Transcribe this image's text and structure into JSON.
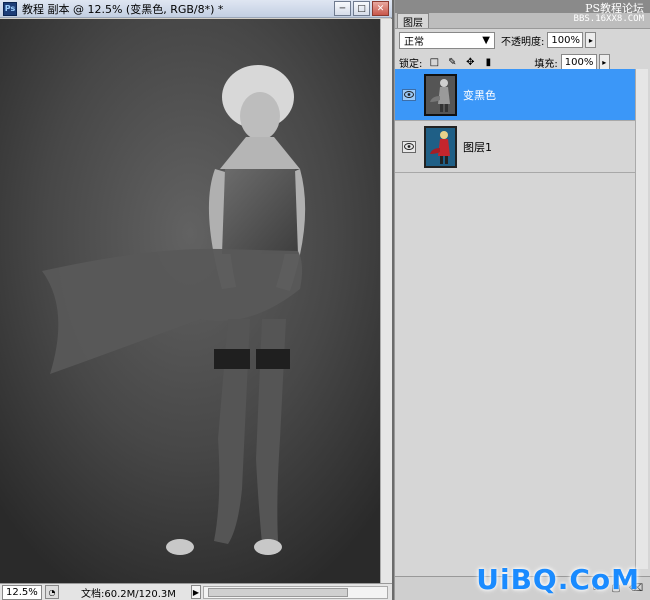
{
  "document": {
    "app_icon": "Ps",
    "title": "教程 副本 @ 12.5% (变黑色, RGB/8*) *",
    "window_buttons": {
      "minimize": "─",
      "maximize": "□",
      "close": "✕"
    },
    "status": {
      "zoom": "12.5%",
      "doc_info": "文档:60.2M/120.3M",
      "arrow": "▶"
    }
  },
  "panel": {
    "tab": "图层",
    "watermark_top": "PS教程论坛",
    "watermark_top_sub": "BBS.16XX8.COM",
    "blend_mode": "正常",
    "blend_arrow": "▼",
    "opacity_label": "不透明度:",
    "opacity_value": "100%",
    "lock_label": "锁定:",
    "lock_icons": [
      "lock-transparent-icon",
      "lock-brush-icon",
      "lock-move-icon",
      "lock-all-icon"
    ],
    "fill_label": "填充:",
    "fill_value": "100%",
    "stepper_arrow": "▸",
    "layers": [
      {
        "name": "变黑色",
        "selected": true,
        "visible": true
      },
      {
        "name": "图层1",
        "selected": false,
        "visible": true
      }
    ],
    "watermark_bottom": "UiBQ.CoM"
  }
}
